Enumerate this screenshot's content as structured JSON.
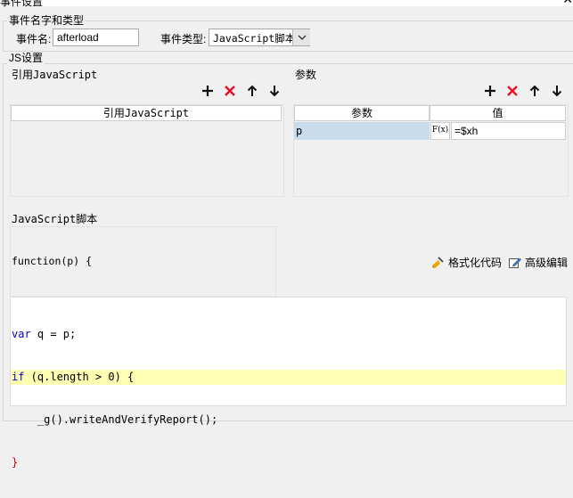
{
  "window": {
    "title": "事件设置",
    "close_glyph": "✕"
  },
  "event_group": {
    "legend": "事件名字和类型",
    "name_label": "事件名:",
    "name_value": "afterload",
    "type_label": "事件类型:",
    "type_value": "JavaScript脚本"
  },
  "js_group": {
    "legend": "JS设置",
    "ref_js": {
      "label": "引用JavaScript",
      "column_header": "引用JavaScript"
    },
    "params": {
      "label": "参数",
      "headers": [
        "参数",
        "值"
      ],
      "rows": [
        {
          "name": "p",
          "formula_glyph": "F(x)",
          "value": "=$xh"
        }
      ]
    },
    "script": {
      "label": "JavaScript脚本",
      "signature": "function(p) {",
      "format_label": "格式化代码",
      "advanced_label": "高级编辑",
      "lines": [
        {
          "kw": "var",
          "text": " q = p;"
        },
        {
          "kw": "if",
          "text": " (q.length > 0) {"
        },
        {
          "kw": "",
          "text": "    _g().writeAndVerifyReport();"
        },
        {
          "kw": "",
          "text": "}"
        }
      ]
    }
  },
  "colors": {
    "accent_red": "#e81123",
    "selection": "#c9dcec",
    "current_line": "#ffffb4"
  }
}
